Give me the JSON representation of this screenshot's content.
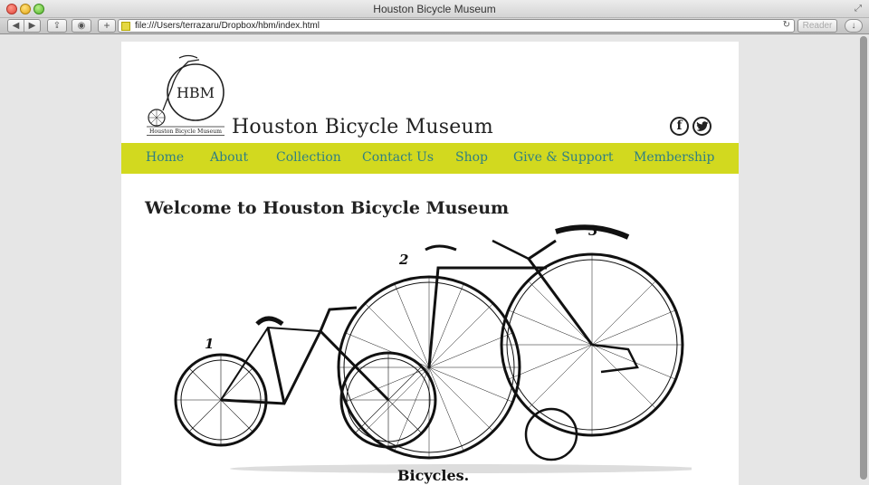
{
  "window": {
    "title": "Houston Bicycle Museum"
  },
  "toolbar": {
    "back": "◀",
    "forward": "▶",
    "share": "⇪",
    "add": "+",
    "url": "file:///Users/terrazaru/Dropbox/hbm/index.html",
    "reload": "↻",
    "reader": "Reader"
  },
  "header": {
    "logo_text": "HBM",
    "logo_caption": "Houston Bicycle Museum",
    "title": "Houston Bicycle Museum",
    "social": {
      "facebook": "f",
      "twitter": "t"
    }
  },
  "nav": {
    "items": [
      "Home",
      "About",
      "Collection",
      "Contact Us",
      "Shop",
      "Give & Support",
      "Membership"
    ]
  },
  "main": {
    "heading": "Welcome to Houston Bicycle Museum",
    "illustration": {
      "labels": [
        "1",
        "2",
        "3"
      ],
      "caption": "Bicycles."
    }
  },
  "colors": {
    "nav_bg": "#d2d91f",
    "nav_text": "#2f7f83"
  }
}
